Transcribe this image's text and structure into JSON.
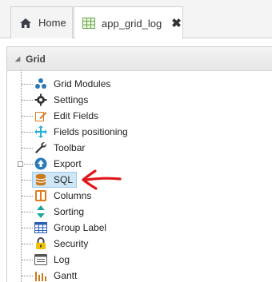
{
  "tabs": [
    {
      "label": "Home",
      "icon": "home-icon"
    },
    {
      "label": "app_grid_log",
      "icon": "grid-icon",
      "close": "✖"
    }
  ],
  "panel": {
    "title": "Grid"
  },
  "tree": [
    {
      "label": "Grid Modules",
      "icon": "modules-icon"
    },
    {
      "label": "Settings",
      "icon": "gear-icon"
    },
    {
      "label": "Edit Fields",
      "icon": "edit-icon"
    },
    {
      "label": "Fields positioning",
      "icon": "move-icon"
    },
    {
      "label": "Toolbar",
      "icon": "wrench-icon"
    },
    {
      "label": "Export",
      "icon": "export-icon"
    },
    {
      "label": "SQL",
      "icon": "database-icon",
      "selected": true
    },
    {
      "label": "Columns",
      "icon": "columns-icon"
    },
    {
      "label": "Sorting",
      "icon": "sort-icon"
    },
    {
      "label": "Group Label",
      "icon": "table-icon"
    },
    {
      "label": "Security",
      "icon": "lock-icon"
    },
    {
      "label": "Log",
      "icon": "log-icon"
    },
    {
      "label": "Gantt",
      "icon": "gantt-icon"
    }
  ],
  "colors": {
    "accent": "#e0161b",
    "selected_bg": "#cfe6f7",
    "icon_blue": "#2a7ab8"
  }
}
